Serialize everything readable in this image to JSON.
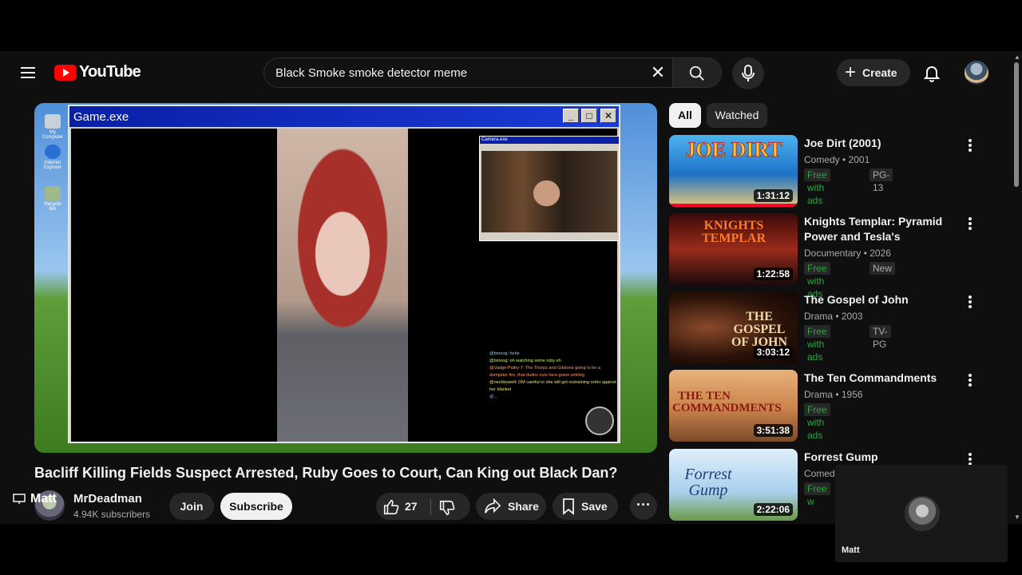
{
  "app": {
    "logo_text": "YouTube",
    "brand_color": "#ff0000"
  },
  "header": {
    "search_query": "Black Smoke smoke detector meme",
    "create_label": "Create"
  },
  "player": {
    "window_title": "Game.exe",
    "cam_window_title": "Camera.exe",
    "desktop_icons": [
      "My Computer",
      "Internet Explorer",
      "Recycle Bin"
    ],
    "chat_lines": [
      "@bmoog: hehe",
      "@bmoog: oh watching some ruby eh",
      "@Vadge-Paltry-7: The Thorps and Gibbons going to be a dumpster fire, that dudes nuts face-grave smiling",
      "@neckbowelt: DM careful or she will get restraining order against her blanket",
      "@..."
    ]
  },
  "video": {
    "title": "Bacliff Killing Fields Suspect Arrested, Ruby Goes to Court, Can King out Black Dan?",
    "channel_name": "MrDeadman",
    "subscribers": "4.94K subscribers",
    "join_label": "Join",
    "subscribe_label": "Subscribe",
    "likes": "27",
    "share_label": "Share",
    "save_label": "Save",
    "overlay_user": "Matt"
  },
  "chips": [
    "All",
    "Watched"
  ],
  "recommendations": [
    {
      "title": "Joe Dirt (2001)",
      "meta": "Comedy • 2001",
      "badges": [
        "Free with ads",
        "PG-13"
      ],
      "duration": "1:31:12",
      "thumb_text": "JOE DIRT"
    },
    {
      "title": "Knights Templar: Pyramid Power and Tesla's Forbidden ...",
      "meta": "Documentary • 2026",
      "badges": [
        "Free with ads",
        "New"
      ],
      "duration": "1:22:58",
      "thumb_text": "KNIGHTS TEMPLAR"
    },
    {
      "title": "The Gospel of John",
      "meta": "Drama • 2003",
      "badges": [
        "Free with ads",
        "TV-PG"
      ],
      "duration": "3:03:12",
      "thumb_text": "THE GOSPEL OF JOHN"
    },
    {
      "title": "The Ten Commandments",
      "meta": "Drama • 1956",
      "badges": [
        "Free with ads"
      ],
      "duration": "3:51:38",
      "thumb_text": "THE TEN COMMANDMENTS"
    },
    {
      "title": "Forrest Gump",
      "meta": "Comedy",
      "badges": [
        "Free w"
      ],
      "duration": "2:22:06",
      "thumb_text": "Forrest Gump"
    }
  ],
  "float_card": {
    "name": "Matt"
  }
}
